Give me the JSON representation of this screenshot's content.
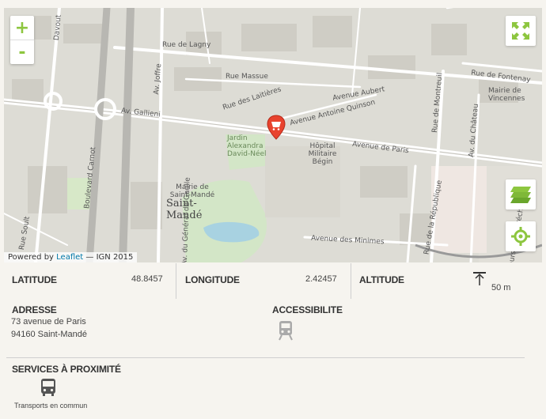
{
  "map": {
    "attribution": {
      "prefix": "Powered by",
      "link": "Leaflet",
      "suffix": "— IGN 2015"
    },
    "zoom": {
      "in": "+",
      "out": "-"
    },
    "street_labels": {
      "rue_de_lagny": "Rue de Lagny",
      "avenue_de_paris": "Avenue de Paris",
      "av_gallieni": "Av. Gallieni",
      "rue_de_fontenay": "Rue de Fontenay",
      "av_joffre": "Av. Joffre",
      "rue_massue": "Rue Massue",
      "rue_des_laitieres": "Rue des Laitières",
      "avenue_aubert": "Avenue Aubert",
      "avenue_antoine_quinson": "Avenue Antoine Quinson",
      "rue_de_montreuil": "Rue de Montreuil",
      "av_du_chateau": "Av. du Château",
      "mairie_de_vincennes": "Mairie de Vincennes",
      "jardin": "Jardin Alexandra David-Néel",
      "hopital": "Hôpital Militaire Bégin",
      "mairie_saint_mande": "Mairie de Saint-Mandé",
      "saint_mande": "Saint-Mandé",
      "avenue_des_minimes": "Avenue des Minimes",
      "boulevard_carnot": "Boulevard Carnot",
      "rue_de_la_republique": "Rue de la République",
      "av_general_de_gaulle": "Av. du Général de Gaulle",
      "cours_des_maréchaux": "Cours des Maréchaux",
      "davout": "Davout",
      "rue_soult": "Rue Soult"
    }
  },
  "details": {
    "latitude_label": "LATITUDE",
    "latitude_value": "48.8457",
    "longitude_label": "LONGITUDE",
    "longitude_value": "2.42457",
    "altitude_label": "ALTITUDE",
    "altitude_value": "50 m",
    "address_label": "ADRESSE",
    "address_line1": "73 avenue de Paris",
    "address_line2": "94160 Saint-Mandé",
    "accessibility_label": "ACCESSIBILITE",
    "services_label": "SERVICES À PROXIMITÉ",
    "service_transport": "Transports en commun"
  },
  "colors": {
    "accent": "#8dc63f",
    "marker": "#e8432e",
    "road": "#ffffff",
    "park": "#d0e4c4",
    "water": "#aad3df"
  },
  "icons": [
    "plus-icon",
    "minus-icon",
    "fullscreen-icon",
    "layers-icon",
    "locate-icon",
    "marker-icon",
    "altitude-icon",
    "train-icon",
    "bus-icon"
  ]
}
